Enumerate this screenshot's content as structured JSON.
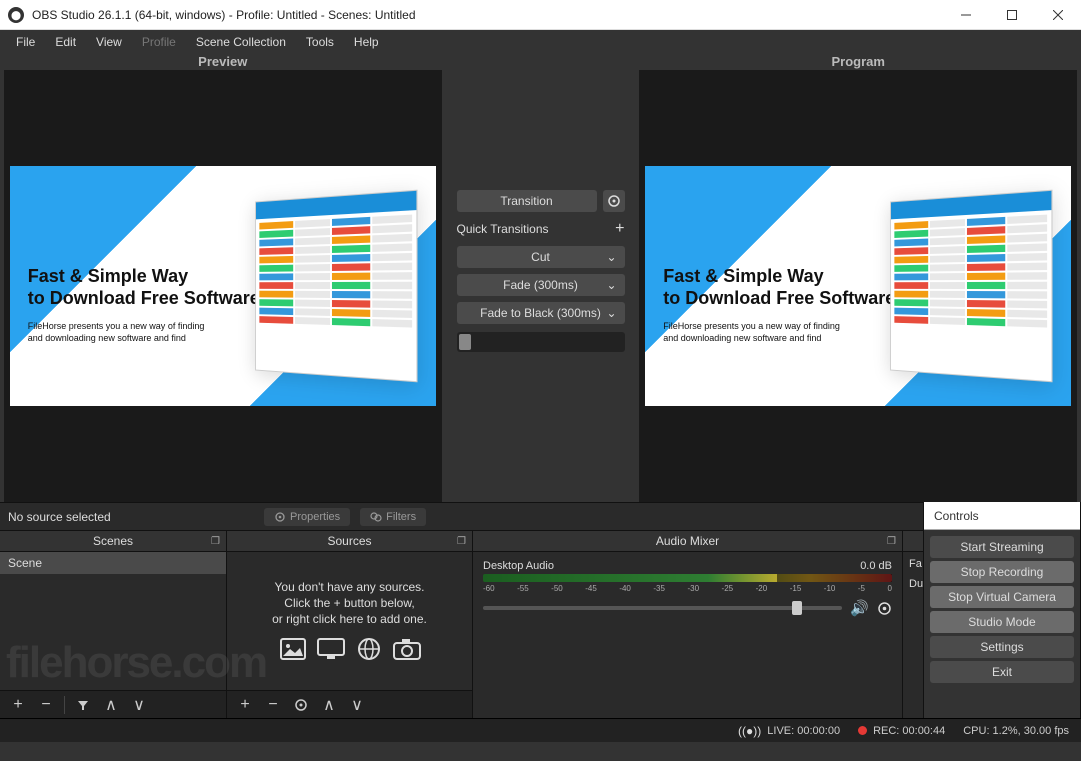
{
  "titlebar": {
    "title": "OBS Studio 26.1.1 (64-bit, windows) - Profile: Untitled - Scenes: Untitled"
  },
  "menu": {
    "items": [
      "File",
      "Edit",
      "View",
      "Profile",
      "Scene Collection",
      "Tools",
      "Help"
    ]
  },
  "labels": {
    "preview": "Preview",
    "program": "Program"
  },
  "preview_content": {
    "headline": "Fast & Simple Way\nto Download Free Software",
    "subtext": "FileHorse presents you a new way of finding\nand downloading new software and find"
  },
  "center": {
    "transition": "Transition",
    "quick_label": "Quick Transitions",
    "items": [
      "Cut",
      "Fade (300ms)",
      "Fade to Black (300ms)"
    ]
  },
  "srcinfo": {
    "text": "No source selected",
    "properties": "Properties",
    "filters": "Filters"
  },
  "docks": {
    "scenes": {
      "title": "Scenes",
      "rows": [
        "Scene"
      ]
    },
    "sources": {
      "title": "Sources",
      "empty1": "You don't have any sources.",
      "empty2": "Click the + button below,",
      "empty3": "or right click here to add one."
    },
    "mixer": {
      "title": "Audio Mixer",
      "track": "Desktop Audio",
      "level": "0.0 dB",
      "ticks": [
        "-60",
        "-55",
        "-50",
        "-45",
        "-40",
        "-35",
        "-30",
        "-25",
        "-20",
        "-15",
        "-10",
        "-5",
        "0"
      ]
    },
    "trans": {
      "title": "",
      "row1": "Fa",
      "row2": "Dura"
    },
    "controls": {
      "title": "Controls",
      "buttons": [
        "Start Streaming",
        "Stop Recording",
        "Stop Virtual Camera",
        "Studio Mode",
        "Settings",
        "Exit"
      ]
    }
  },
  "statusbar": {
    "live": "LIVE: 00:00:00",
    "rec": "REC: 00:00:44",
    "cpu": "CPU: 1.2%, 30.00 fps"
  },
  "watermark": "filehorse.com"
}
